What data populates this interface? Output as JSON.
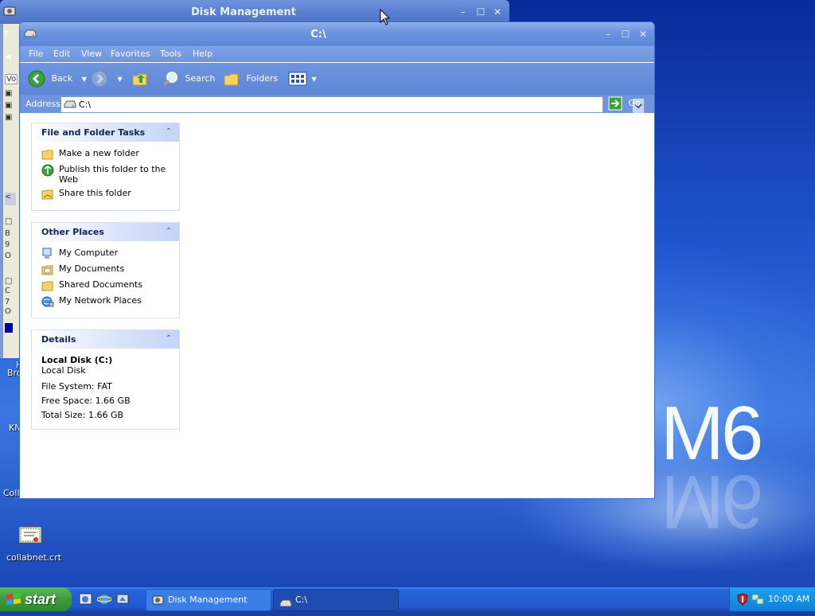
{
  "desktop": {
    "wallpaper_text": "M6",
    "icons": [
      {
        "label": "collabnet.crt"
      }
    ],
    "partial_labels": [
      "Bro",
      "KN",
      "Coll"
    ]
  },
  "disk_management": {
    "title": "Disk Management",
    "menu_partial": "F",
    "column_partial": "Vo",
    "disk_rows": [
      {
        "line1": "B",
        "line2": "9",
        "line3": "O"
      },
      {
        "line1": "C",
        "line2": "7",
        "line3": "O"
      }
    ]
  },
  "explorer": {
    "title": "C:\\",
    "menu": [
      "File",
      "Edit",
      "View",
      "Favorites",
      "Tools",
      "Help"
    ],
    "toolbar": {
      "back": "Back",
      "search": "Search",
      "folders": "Folders"
    },
    "address": {
      "label": "Address",
      "value": "C:\\",
      "go": "Go"
    },
    "panels": {
      "file_tasks": {
        "title": "File and Folder Tasks",
        "items": [
          "Make a new folder",
          "Publish this folder to the Web",
          "Share this folder"
        ]
      },
      "other_places": {
        "title": "Other Places",
        "items": [
          "My Computer",
          "My Documents",
          "Shared Documents",
          "My Network Places"
        ]
      },
      "details": {
        "title": "Details",
        "name": "Local Disk (C:)",
        "type": "Local Disk",
        "file_system": "File System: FAT",
        "free_space": "Free Space: 1.66 GB",
        "total_size": "Total Size: 1.66 GB"
      }
    }
  },
  "taskbar": {
    "start": "start",
    "buttons": [
      "Disk Management",
      "C:\\"
    ],
    "clock": "10:00 AM"
  }
}
